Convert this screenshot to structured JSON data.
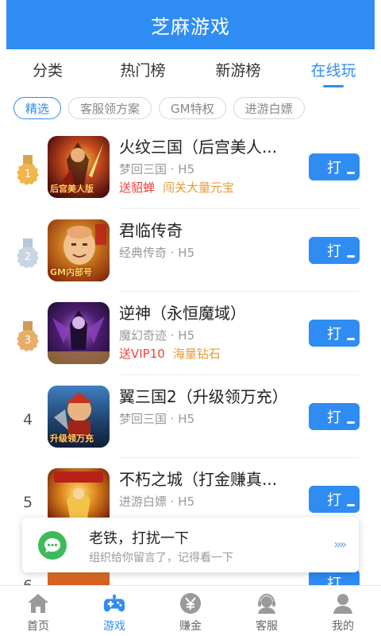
{
  "header": {
    "title": "芝麻游戏"
  },
  "tabs": [
    {
      "label": "分类"
    },
    {
      "label": "热门榜"
    },
    {
      "label": "新游榜"
    },
    {
      "label": "在线玩"
    }
  ],
  "filters": [
    {
      "label": "精选"
    },
    {
      "label": "客服领方案"
    },
    {
      "label": "GM特权"
    },
    {
      "label": "进游白嫖"
    }
  ],
  "games": [
    {
      "rank": "1",
      "name": "火纹三国（后宫美人...",
      "sub": "梦回三国 · H5",
      "tag_red": "送貂蝉",
      "tag_orange": "闯关大量元宝",
      "icon_text": "后宫美人版",
      "button": "打"
    },
    {
      "rank": "2",
      "name": "君临传奇",
      "sub": "经典传奇 · H5",
      "tag_red": "",
      "tag_orange": "",
      "icon_text": "GM内部号",
      "button": "打"
    },
    {
      "rank": "3",
      "name": "逆神（永恒魔域）",
      "sub": "魔幻奇迹 · H5",
      "tag_red": "送VIP10",
      "tag_orange": "海量钻石",
      "icon_text": "",
      "button": "打"
    },
    {
      "rank": "4",
      "name": "翼三国2（升级领万充）",
      "sub": "梦回三国 · H5",
      "tag_red": "",
      "tag_orange": "",
      "icon_text": "升级领万充",
      "button": "打"
    },
    {
      "rank": "5",
      "name": "不朽之城（打金赚真...",
      "sub": "进游白嫖 · H5",
      "tag_red": "",
      "tag_orange": "",
      "icon_text": "",
      "button": "打"
    },
    {
      "rank": "6",
      "name": "",
      "sub": "",
      "tag_red": "",
      "tag_orange": "",
      "icon_text": "",
      "button": "打"
    }
  ],
  "toast": {
    "title": "老铁，打扰一下",
    "message": "组织给你留言了，记得看一下",
    "arrows": "»»"
  },
  "bottom_nav": [
    {
      "label": "首页",
      "icon": "home-icon"
    },
    {
      "label": "游戏",
      "icon": "gamepad-icon"
    },
    {
      "label": "赚金",
      "icon": "yen-coin-icon"
    },
    {
      "label": "客服",
      "icon": "headset-icon"
    },
    {
      "label": "我的",
      "icon": "person-icon"
    }
  ],
  "colors": {
    "brand": "#2f8cf3",
    "tag_red": "#f0413c",
    "tag_orange": "#e89b36",
    "toast_green": "#3dbb5a"
  }
}
